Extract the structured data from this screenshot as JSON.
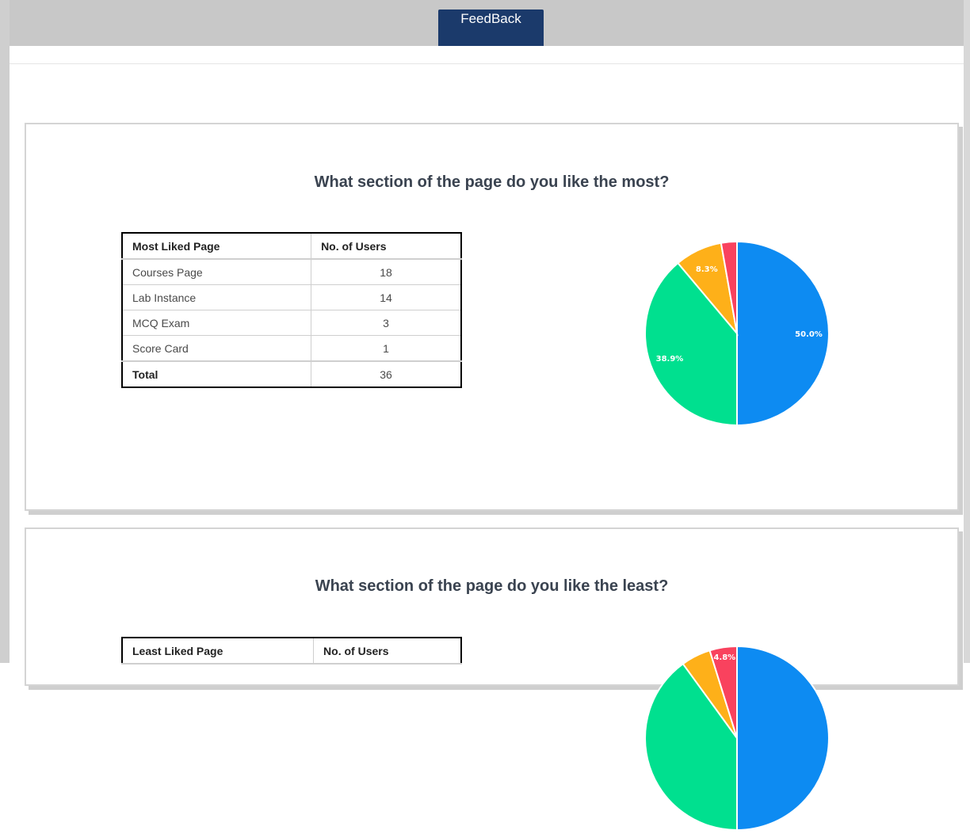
{
  "header": {
    "tab_label": "FeedBack"
  },
  "colors": {
    "tab_bg": "#1b3a6b",
    "series": [
      "#0d8bf2",
      "#00e08f",
      "#feb019",
      "#f9425e"
    ]
  },
  "sections": [
    {
      "title": "What section of the page do you like the most?",
      "table": {
        "headers": [
          "Most Liked Page",
          "No. of Users"
        ],
        "rows": [
          [
            "Courses Page",
            "18"
          ],
          [
            "Lab Instance",
            "14"
          ],
          [
            "MCQ Exam",
            "3"
          ],
          [
            "Score Card",
            "1"
          ]
        ],
        "total_label": "Total",
        "total_value": "36"
      }
    },
    {
      "title": "What section of the page do you like the least?",
      "table": {
        "headers": [
          "Least Liked Page",
          "No. of Users"
        ]
      }
    }
  ],
  "chart_data": [
    {
      "type": "pie",
      "categories": [
        "Courses Page",
        "Lab Instance",
        "MCQ Exam",
        "Score Card"
      ],
      "values": [
        18,
        14,
        3,
        1
      ],
      "slice_labels": [
        "50.0%",
        "38.9%",
        "8.3%",
        ""
      ]
    },
    {
      "type": "pie",
      "slice_labels": [
        "4.8%"
      ]
    }
  ]
}
